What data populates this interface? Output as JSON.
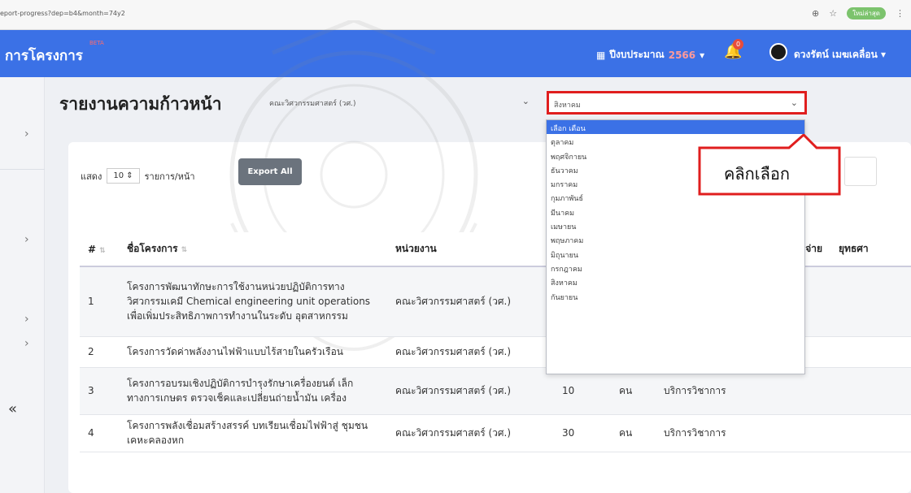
{
  "browser": {
    "url": "eport-progress?dep=b4&month=74y2",
    "profile_label": "ใหม่ล่าสุด"
  },
  "nav": {
    "brand": "การโครงการ",
    "beta": "BETA",
    "budget_label": "ปีงบประมาณ",
    "budget_year": "2566",
    "notification_count": "0",
    "user_name": "ดวงรัตน์ เมฆเคลื่อน"
  },
  "page": {
    "title": "รายงานความก้าวหน้า",
    "department_select": "คณะวิศวกรรมศาสตร์ (วศ.)",
    "month_select": "สิงหาคม"
  },
  "month_options": [
    {
      "label": "เลือก เดือน",
      "selected": true
    },
    {
      "label": "ตุลาคม",
      "selected": false
    },
    {
      "label": "พฤศจิกายน",
      "selected": false
    },
    {
      "label": "ธันวาคม",
      "selected": false
    },
    {
      "label": "มกราคม",
      "selected": false
    },
    {
      "label": "กุมภาพันธ์",
      "selected": false
    },
    {
      "label": "มีนาคม",
      "selected": false
    },
    {
      "label": "เมษายน",
      "selected": false
    },
    {
      "label": "พฤษภาคม",
      "selected": false
    },
    {
      "label": "มิถุนายน",
      "selected": false
    },
    {
      "label": "กรกฎาคม",
      "selected": false
    },
    {
      "label": "สิงหาคม",
      "selected": false
    },
    {
      "label": "กันยายน",
      "selected": false
    }
  ],
  "annotation": {
    "text": "คลิกเลือก",
    "color": "#e01e1e"
  },
  "controls": {
    "show_label": "แสดง",
    "page_size": "10",
    "per_page_label": "รายการ/หน้า",
    "export_label": "Export All"
  },
  "table": {
    "headers": {
      "num": "#",
      "name": "ชื่อโครงการ",
      "unit": "หน่วยงาน",
      "expense": "ใช้จ่าย",
      "strategy": "ยุทธศา"
    },
    "rows": [
      {
        "num": "1",
        "name": "โครงการพัฒนาทักษะการใช้งานหน่วยปฏิบัติการทาง วิศวกรรมเคมี Chemical engineering unit operations เพื่อเพิ่มประสิทธิภาพการทำงานในระดับ อุตสาหกรรม",
        "unit": "คณะวิศวกรรมศาสตร์ (วศ.)",
        "qty": "",
        "qty_unit": "",
        "type": ""
      },
      {
        "num": "2",
        "name": "โครงการวัดค่าพลังงานไฟฟ้าแบบไร้สายในครัวเรือน",
        "unit": "คณะวิศวกรรมศาสตร์ (วศ.)",
        "qty": "",
        "qty_unit": "",
        "type": ""
      },
      {
        "num": "3",
        "name": "โครงการอบรมเชิงปฏิบัติการบำรุงรักษาเครื่องยนต์ เล็กทางการเกษตร ตรวจเช็คและเปลี่ยนถ่ายน้ำมัน เครื่อง",
        "unit": "คณะวิศวกรรมศาสตร์ (วศ.)",
        "qty": "10",
        "qty_unit": "คน",
        "type": "บริการวิชาการ"
      },
      {
        "num": "4",
        "name": "โครงการพลังเชื่อมสร้างสรรค์ บทเรียนเชื่อมไฟฟ้าสู่ ชุมชนเคหะคลองหก",
        "unit": "คณะวิศวกรรมศาสตร์ (วศ.)",
        "qty": "30",
        "qty_unit": "คน",
        "type": "บริการวิชาการ"
      }
    ]
  }
}
